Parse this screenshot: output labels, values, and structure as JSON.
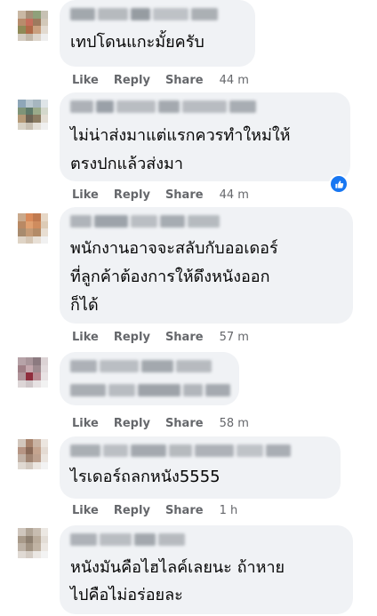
{
  "labels": {
    "like": "Like",
    "reply": "Reply",
    "share": "Share"
  },
  "comments": [
    {
      "text_lines": [
        "เทปโดนแกะมั้ยครับ"
      ],
      "time": "44 m"
    },
    {
      "text_lines": [
        "ไม่น่าส่งมาแต่แรกควรทำใหม่ให้",
        "ตรงปกแล้วส่งมา"
      ],
      "time": "44 m",
      "reaction": "like-icon"
    },
    {
      "text_lines": [
        "พนักงานอาจจะสลับกับออเดอร์",
        "ที่ลูกค้าต้องการให้ดึงหนังออก",
        "ก็ได้"
      ],
      "time": "57 m"
    },
    {
      "text_lines": [],
      "time": "58 m"
    },
    {
      "text_lines": [
        "ไรเดอร์ถลกหนัง5555"
      ],
      "time": "1 h"
    },
    {
      "text_lines": [
        "หนังมันคือไฮไลค์เลยนะ ถ้าหาย",
        "ไปคือไม่อร่อยละ"
      ]
    }
  ],
  "colors": {
    "bubble": "#f0f2f5",
    "meta": "#65676b",
    "reaction_blue": "#1877f2"
  }
}
